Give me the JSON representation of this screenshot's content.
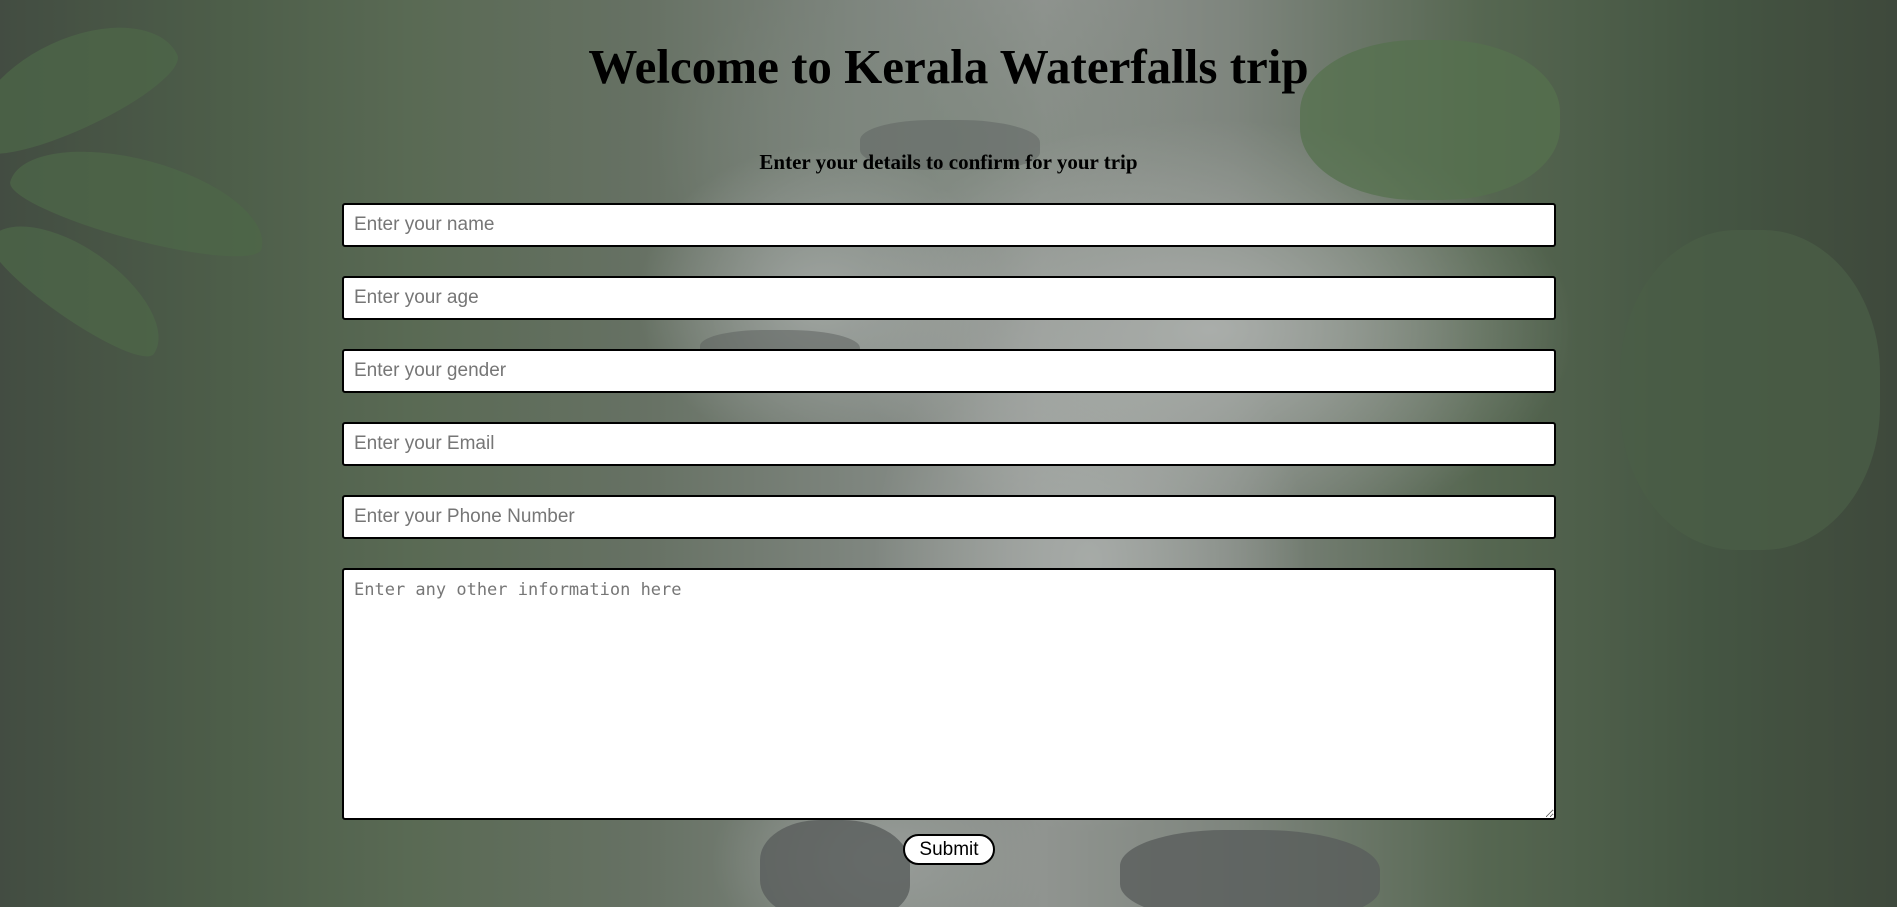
{
  "header": {
    "title": "Welcome to Kerala Waterfalls trip",
    "subtitle": "Enter your details to confirm for your trip"
  },
  "form": {
    "name": {
      "placeholder": "Enter your name",
      "value": ""
    },
    "age": {
      "placeholder": "Enter your age",
      "value": ""
    },
    "gender": {
      "placeholder": "Enter your gender",
      "value": ""
    },
    "email": {
      "placeholder": "Enter your Email",
      "value": ""
    },
    "phone": {
      "placeholder": "Enter your Phone Number",
      "value": ""
    },
    "other_info": {
      "placeholder": "Enter any other information here",
      "value": ""
    },
    "submit_label": "Submit"
  },
  "background": {
    "subject": "forest waterfall photo",
    "overlay_color": "#5f6460"
  }
}
